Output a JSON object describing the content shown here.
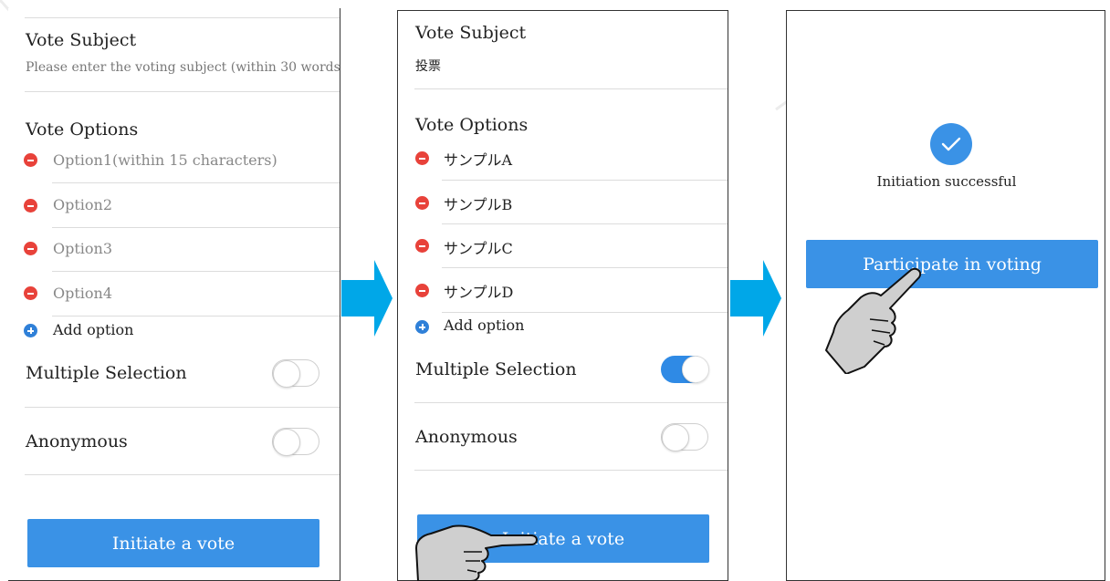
{
  "panel1": {
    "subject_heading": "Vote Subject",
    "subject_placeholder": "Please enter the voting subject (within 30 words)",
    "options_heading": "Vote Options",
    "options": [
      "Option1(within 15 characters)",
      "Option2",
      "Option3",
      "Option4"
    ],
    "add_option": "Add option",
    "multiple_selection": "Multiple Selection",
    "multiple_selection_on": false,
    "anonymous": "Anonymous",
    "anonymous_on": false,
    "initiate_button": "Initiate a vote"
  },
  "panel2": {
    "subject_heading": "Vote Subject",
    "subject_value": "投票",
    "options_heading": "Vote Options",
    "options": [
      "サンプルA",
      "サンプルB",
      "サンプルC",
      "サンプルD"
    ],
    "add_option": "Add option",
    "multiple_selection": "Multiple Selection",
    "multiple_selection_on": true,
    "anonymous": "Anonymous",
    "anonymous_on": false,
    "initiate_button": "Initiate a vote"
  },
  "panel3": {
    "success_text": "Initiation successful",
    "participate_button": "Participate in voting"
  },
  "colors": {
    "accent": "#3a92e6",
    "arrow": "#00a7e8",
    "remove": "#e8423a",
    "add": "#2f80d8"
  },
  "icons": {
    "remove": "minus-circle-icon",
    "add": "plus-circle-icon",
    "success": "check-circle-icon",
    "flow_arrow": "right-arrow-icon",
    "pointer": "pointing-hand-icon"
  }
}
